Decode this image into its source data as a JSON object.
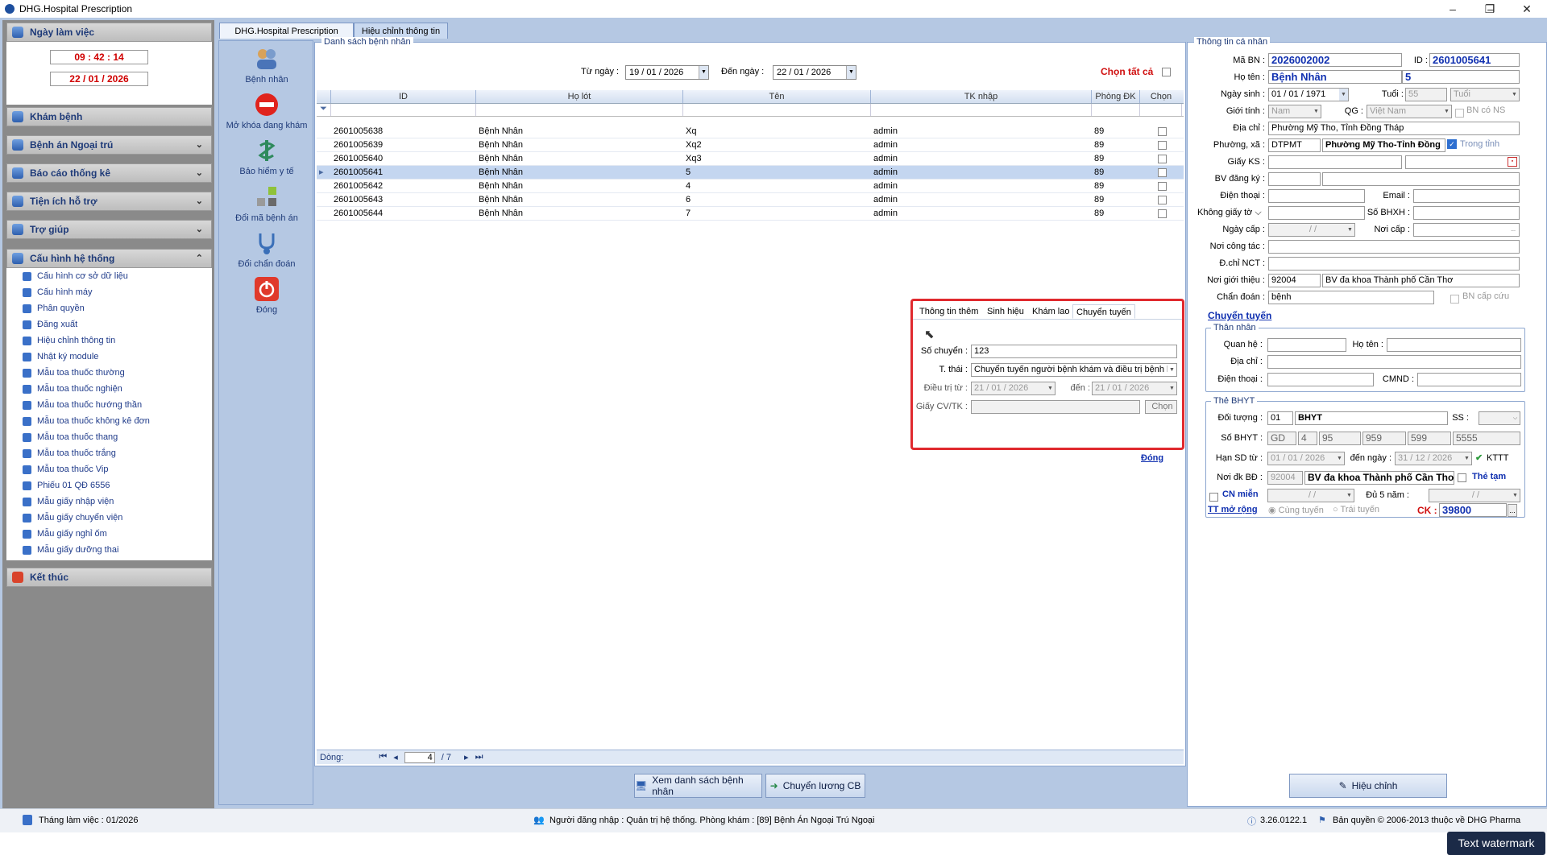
{
  "window": {
    "title": "DHG.Hospital Prescription",
    "minimize": "–",
    "maximize": "❐",
    "close": "✕"
  },
  "left": {
    "work_day_header": "Ngày làm việc",
    "time": "09 : 42 : 14",
    "date": "22 / 01 / 2026",
    "sections": [
      "Khám bệnh",
      "Bệnh án Ngoại trú",
      "Báo cáo thống kê",
      "Tiện ích hỗ trợ",
      "Trợ giúp",
      "Cấu hình hệ thống",
      "Kết thúc"
    ],
    "config_items": [
      "Cấu hình cơ sở dữ liệu",
      "Cấu hình máy",
      "Phân quyền",
      "Đăng xuất",
      "Hiệu chỉnh thông tin",
      "Nhật ký module",
      "Mẫu toa thuốc thường",
      "Mẫu toa thuốc nghiện",
      "Mẫu toa thuốc hướng thần",
      "Mẫu toa thuốc không kê đơn",
      "Mẫu toa thuốc thang",
      "Mẫu toa thuốc trắng",
      "Mẫu toa thuốc Vip",
      "Phiếu 01 QĐ 6556",
      "Mẫu giấy nhập viện",
      "Mẫu giấy chuyển viện",
      "Mẫu giấy nghỉ ốm",
      "Mẫu giấy dưỡng thai"
    ]
  },
  "tabs": [
    "DHG.Hospital Prescription",
    "Hiệu chỉnh thông tin"
  ],
  "toolbar": [
    "Bệnh nhân",
    "Mở khóa đang khám",
    "Bảo hiểm y tế",
    "Đổi mã bệnh án",
    "Đổi chẩn đoán",
    "Đóng"
  ],
  "list": {
    "legend": "Danh sách bệnh nhân",
    "from_label": "Từ ngày :",
    "from_value": "19 / 01 / 2026",
    "to_label": "Đến  ngày :",
    "to_value": "22 / 01 / 2026",
    "select_all": "Chọn tất cả",
    "columns": [
      "ID",
      "Họ lót",
      "Tên",
      "TK nhập",
      "Phòng ĐK",
      "Chọn"
    ],
    "rows": [
      [
        "2601005638",
        "Bệnh Nhân",
        "Xq",
        "admin",
        "89"
      ],
      [
        "2601005639",
        "Bệnh Nhân",
        "Xq2",
        "admin",
        "89"
      ],
      [
        "2601005640",
        "Bệnh Nhân",
        "Xq3",
        "admin",
        "89"
      ],
      [
        "2601005641",
        "Bệnh Nhân",
        "5",
        "admin",
        "89"
      ],
      [
        "2601005642",
        "Bệnh Nhân",
        "4",
        "admin",
        "89"
      ],
      [
        "2601005643",
        "Bệnh Nhân",
        "6",
        "admin",
        "89"
      ],
      [
        "2601005644",
        "Bệnh Nhân",
        "7",
        "admin",
        "89"
      ]
    ],
    "nav_label": "Dòng:",
    "nav_current": "4",
    "nav_total": "/ 7"
  },
  "buttons": {
    "view_list": "Xem danh sách bệnh nhân",
    "transfer_cb": "Chuyển lương CB",
    "edit": "Hiệu chỉnh"
  },
  "popup": {
    "tabs": [
      "Thông tin thêm",
      "Sinh hiệu",
      "Khám lao",
      "Chuyển tuyến"
    ],
    "so_chuyen_label": "Số chuyển :",
    "so_chuyen": "123",
    "tthai_label": "T. thái :",
    "tthai": "Chuyển tuyến người bệnh khám và điều trị bệnh lao",
    "dieutri_label": "Điều trị từ :",
    "dieutri_from": "21 / 01 / 2026",
    "den_label": "đến :",
    "dieutri_to": "21 / 01 / 2026",
    "giay_label": "Giấy CV/TK :",
    "chon": "Chọn",
    "close_link": "Đóng"
  },
  "personal": {
    "legend": "Thông tin cá nhân",
    "ma_bn_label": "Mã BN :",
    "ma_bn": "2026002002",
    "id_label": "ID :",
    "id": "2601005641",
    "ho_ten_label": "Họ tên :",
    "ho_ten": "Bệnh Nhân",
    "ten": "5",
    "ngay_sinh_label": "Ngày sinh :",
    "ngay_sinh": "01 / 01 / 1971",
    "tuoi_label": "Tuổi :",
    "tuoi": "55",
    "tuoi_unit": "Tuổi",
    "gioi_tinh_label": "Giới tính :",
    "gioi_tinh": "Nam",
    "qg_label": "QG :",
    "qg": "Việt Nam",
    "bn_co_ns": "BN có NS",
    "dia_chi_label": "Địa chỉ :",
    "dia_chi": "Phường Mỹ Tho, Tỉnh Đồng Tháp",
    "phuong_label": "Phường, xã :",
    "phuong_code": "DTPMT",
    "phuong_name": "Phường Mỹ Tho-Tỉnh Đồng",
    "trong_tinh": "Trong tỉnh",
    "giay_ks_label": "Giấy KS :",
    "bv_dang_ky_label": "BV đăng ký :",
    "dien_thoai_label": "Điện thoại :",
    "email_label": "Email :",
    "khong_giay_label": "Không giấy tờ",
    "so_bhxh_label": "Số BHXH :",
    "ngay_cap_label": "Ngày cấp :",
    "ngay_cap": "/ /",
    "noi_cap_label": "Nơi cấp :",
    "noi_cong_tac_label": "Nơi công tác :",
    "dchi_nct_label": "Đ.chỉ NCT :",
    "noi_gioi_thieu_label": "Nơi giới thiệu :",
    "ngt_code": "92004",
    "ngt_name": "BV đa khoa Thành phố Cần Thơ",
    "chan_doan_label": "Chẩn đoán :",
    "chan_doan": "bệnh",
    "bn_cap_cuu": "BN cấp cứu",
    "chuyen_tuyen_link": "Chuyển tuyến"
  },
  "relatives": {
    "legend": "Thân nhân",
    "quan_he_label": "Quan hệ :",
    "ho_ten_label": "Họ tên :",
    "dia_chi_label": "Địa chỉ :",
    "dien_thoai_label": "Điện thoại :",
    "cmnd_label": "CMND :"
  },
  "insurance": {
    "legend": "Thẻ BHYT",
    "doi_tuong_label": "Đối tượng :",
    "doi_tuong_code": "01",
    "doi_tuong": "BHYT",
    "ss_label": "SS :",
    "so_bhyt_label": "Số BHYT :",
    "so_bhyt": [
      "GD",
      "4",
      "95",
      "959",
      "599",
      "5555"
    ],
    "han_sd_label": "Hạn SD từ :",
    "han_from": "01 / 01 / 2026",
    "den_ngay_label": "đến  ngày :",
    "han_to": "31 / 12 / 2026",
    "kttt": "KTTT",
    "noi_dk_label": "Nơi đk BĐ :",
    "noi_dk_code": "92004",
    "noi_dk_name": "BV đa khoa Thành phố Cần Thơ",
    "the_tam": "Thẻ tạm",
    "cn_mien": "CN miễn",
    "cn_date": "/ /",
    "du5_label": "Đủ 5 năm :",
    "du5_date": "/ /",
    "tt_mo_rong": "TT mở rộng",
    "cung_tuyen": "Cùng tuyến",
    "trai_tuyen": "Trái tuyến",
    "ck_label": "CK :",
    "ck": "39800"
  },
  "status": {
    "month": "Tháng làm việc : 01/2026",
    "user": "Người đăng nhập : Quản trị hệ thống. Phòng khám : [89] Bệnh Án Ngoại Trú Ngoại",
    "version": "3.26.0122.1",
    "copyright": "Bản quyền © 2006-2013 thuộc về DHG Pharma"
  },
  "watermark": "Text watermark"
}
